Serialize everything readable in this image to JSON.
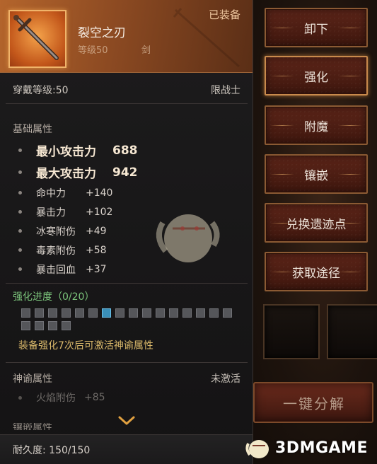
{
  "item": {
    "name": "裂空之刃",
    "level": "等级50",
    "type": "剑",
    "equipped": "已装备",
    "requirement": "穿戴等级:50",
    "class_limit": "限战士"
  },
  "base_attrs": {
    "title": "基础属性",
    "main": [
      {
        "name": "最小攻击力",
        "value": "688"
      },
      {
        "name": "最大攻击力",
        "value": "942"
      }
    ],
    "secondary": [
      {
        "name": "命中力",
        "value": "+140"
      },
      {
        "name": "暴击力",
        "value": "+102"
      },
      {
        "name": "冰寒附伤",
        "value": "+49"
      },
      {
        "name": "毒素附伤",
        "value": "+58"
      },
      {
        "name": "暴击回血",
        "value": "+37"
      }
    ]
  },
  "enhance": {
    "title": "强化进度（0/20）",
    "total": 20,
    "current_index": 6,
    "hint": "装备强化7次后可激活神谕属性"
  },
  "oracle": {
    "title": "神谕属性",
    "state": "未激活",
    "attr_name": "火焰附伤",
    "attr_value": "+85"
  },
  "cut_section": "镶嵌属性",
  "durability": "耐久度:   150/150",
  "actions": [
    "卸下",
    "强化",
    "附魔",
    "镶嵌",
    "兑换遗迹点",
    "获取途径"
  ],
  "active_action": "强化",
  "decompose": "一键分解",
  "watermark": "3DMGAME",
  "colors": {
    "header_orange": "#b4652c",
    "button_red": "#5b2418",
    "enhance_green": "#7bc47b",
    "hint_gold": "#d9b86a",
    "current_square": "#3a8fb8"
  },
  "icons": [
    "sword-icon",
    "chevron-down-icon",
    "mascot-icon"
  ]
}
